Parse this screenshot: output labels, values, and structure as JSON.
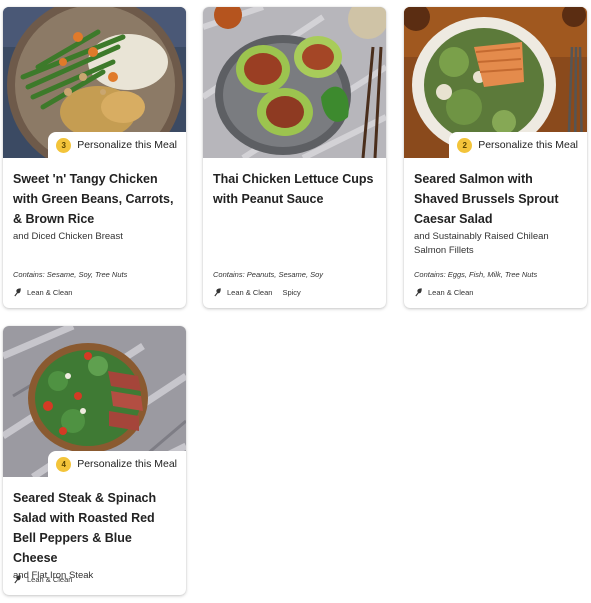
{
  "cards": [
    {
      "title": "Sweet 'n' Tangy Chicken with Green Beans, Carrots, & Brown Rice",
      "subtitle": "and Diced Chicken Breast",
      "contains": "Contains: Sesame, Soy, Tree Nuts",
      "badge_num": "3",
      "badge_label": "Personalize this Meal",
      "tags": [
        "Lean & Clean"
      ]
    },
    {
      "title": "Thai Chicken Lettuce Cups with Peanut Sauce",
      "subtitle": "",
      "contains": "Contains: Peanuts, Sesame, Soy",
      "tags": [
        "Lean & Clean",
        "Spicy"
      ]
    },
    {
      "title": "Seared Salmon with Shaved Brussels Sprout Caesar Salad",
      "subtitle": "and Sustainably Raised Chilean Salmon Fillets",
      "contains": "Contains: Eggs, Fish, Milk, Tree Nuts",
      "badge_num": "2",
      "badge_label": "Personalize this Meal",
      "tags": [
        "Lean & Clean"
      ]
    },
    {
      "title": "Seared Steak & Spinach Salad with Roasted Red Bell Peppers & Blue Cheese",
      "subtitle": "and Flat Iron Steak",
      "contains": "",
      "badge_num": "4",
      "badge_label": "Personalize this Meal",
      "tags": [
        "Lean & Clean"
      ]
    }
  ],
  "colors": {
    "badge": "#f3c43a",
    "card_bg": "#ffffff",
    "text": "#222222"
  },
  "icons": {
    "diet_tag": "leaf-icon"
  }
}
